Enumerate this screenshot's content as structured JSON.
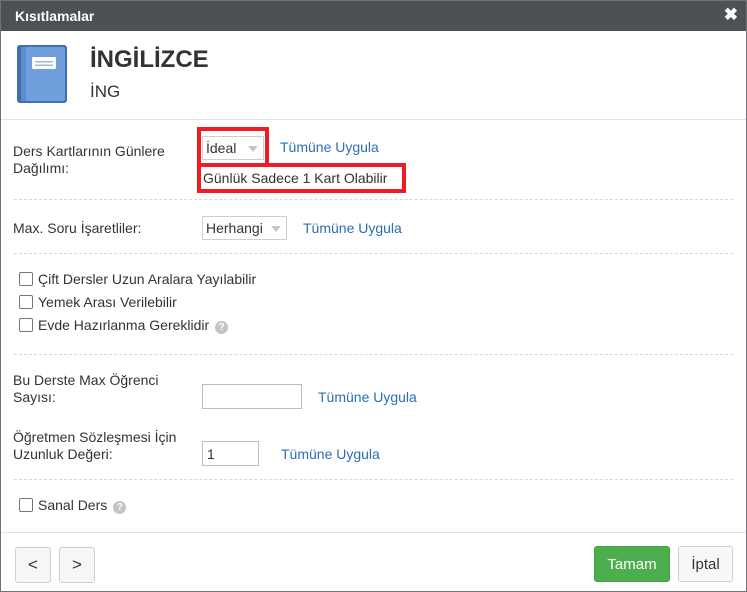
{
  "dialog": {
    "title": "Kısıtlamalar",
    "close_icon": "close-icon"
  },
  "header": {
    "icon": "book-icon",
    "course_name": "İNGİLİZCE",
    "course_code": "İNG"
  },
  "distribution": {
    "label_line1": "Ders Kartlarının Günlere",
    "label_line2": "Dağılımı:",
    "selected": "İdeal",
    "hint": "Günlük Sadece 1 Kart Olabilir",
    "apply": "Tümüne Uygula"
  },
  "max_marks": {
    "label": "Max. Soru İşaretliler:",
    "selected": "Herhangi",
    "apply": "Tümüne Uygula"
  },
  "checkboxes": [
    {
      "label": "Çift Dersler Uzun Aralara Yayılabilir",
      "checked": false
    },
    {
      "label": "Yemek Arası Verilebilir",
      "checked": false
    },
    {
      "label": "Evde Hazırlanma Gereklidir",
      "checked": false,
      "help": true
    }
  ],
  "max_students": {
    "label_line1": "Bu Derste Max Öğrenci",
    "label_line2": "Sayısı:",
    "value": "",
    "apply": "Tümüne Uygula"
  },
  "contract_length": {
    "label_line1": "Öğretmen Sözleşmesi İçin",
    "label_line2": "Uzunluk Değeri:",
    "value": "1",
    "apply": "Tümüne Uygula"
  },
  "virtual": {
    "label": "Sanal Ders",
    "checked": false,
    "help": true
  },
  "footer": {
    "prev": "<",
    "next": ">",
    "ok": "Tamam",
    "cancel": "İptal",
    "ok_color": "#4cae4c"
  },
  "help_symbol": "?"
}
